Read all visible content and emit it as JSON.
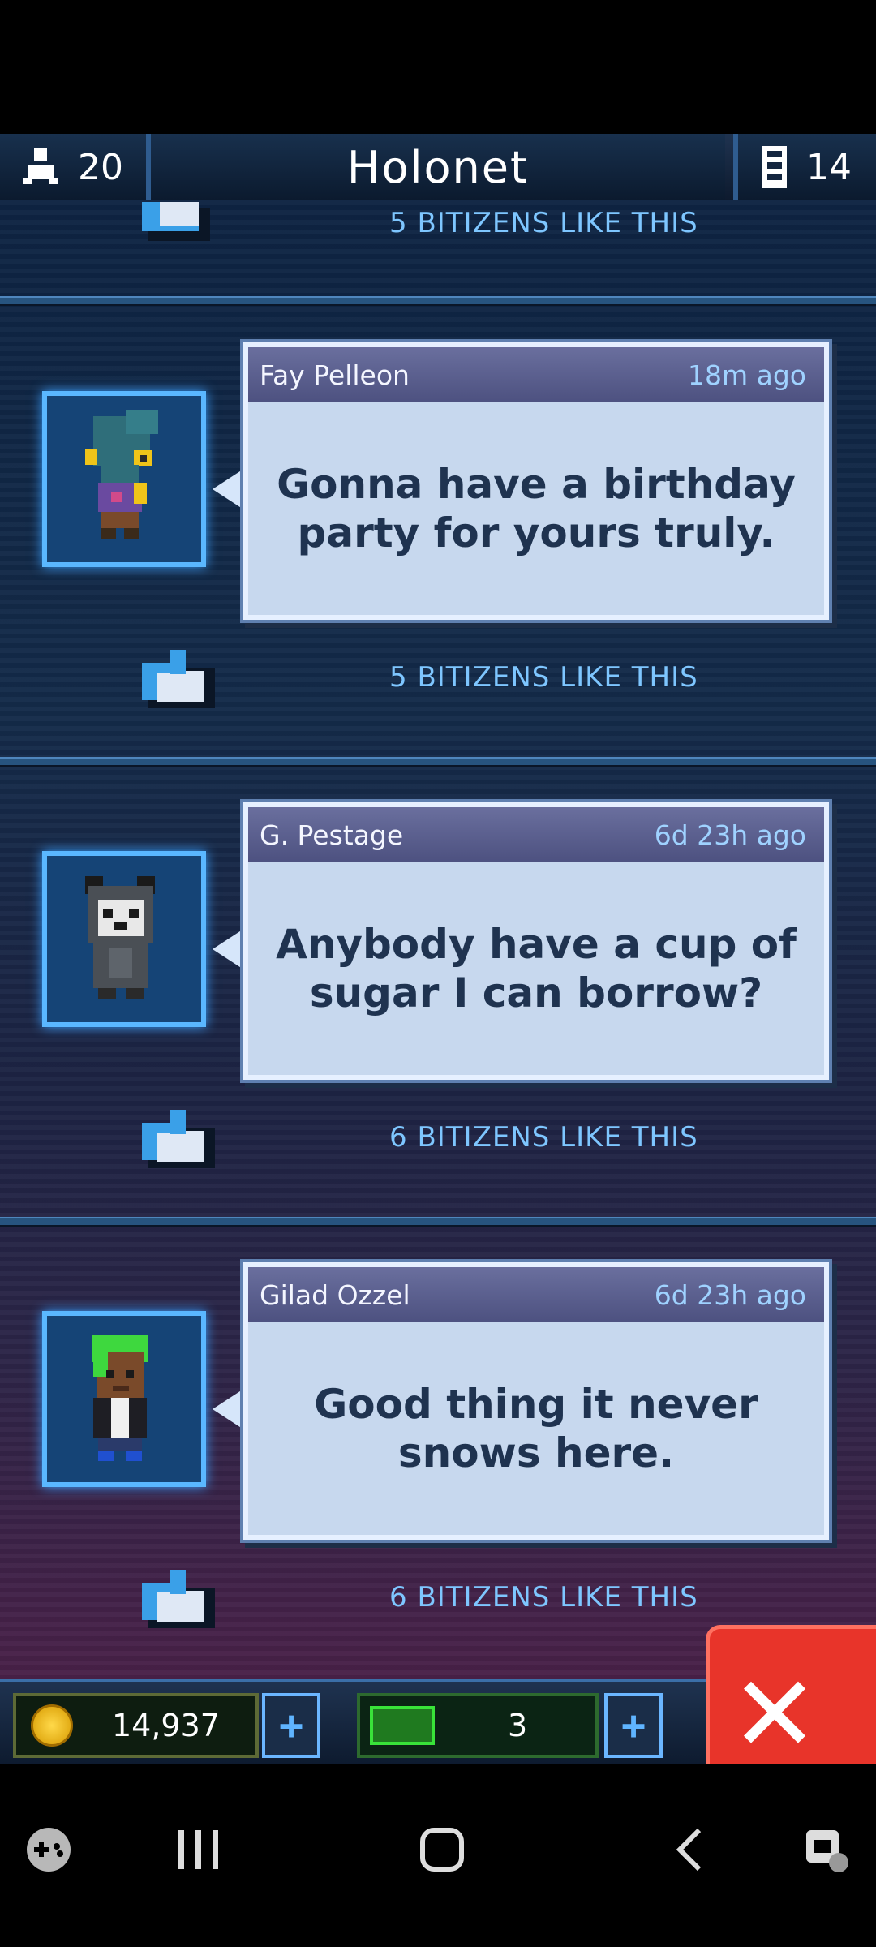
{
  "header": {
    "title": "Holonet",
    "population": "20",
    "floors": "14"
  },
  "top_partial": {
    "likes": "5 BITIZENS LIKE THIS"
  },
  "posts": [
    {
      "name": "Fay Pelleon",
      "time": "18m ago",
      "message": "Gonna have a birthday party for yours truly.",
      "likes": "5 BITIZENS LIKE THIS"
    },
    {
      "name": "G. Pestage",
      "time": "6d 23h ago",
      "message": "Anybody have a cup of sugar I can borrow?",
      "likes": "6 BITIZENS LIKE THIS"
    },
    {
      "name": "Gilad Ozzel",
      "time": "6d 23h ago",
      "message": "Good thing it never snows here.",
      "likes": "6 BITIZENS LIKE THIS"
    }
  ],
  "footer": {
    "coins": "14,937",
    "bux": "3"
  },
  "colors": {
    "accent": "#5ab7ff",
    "close": "#e8342a"
  }
}
